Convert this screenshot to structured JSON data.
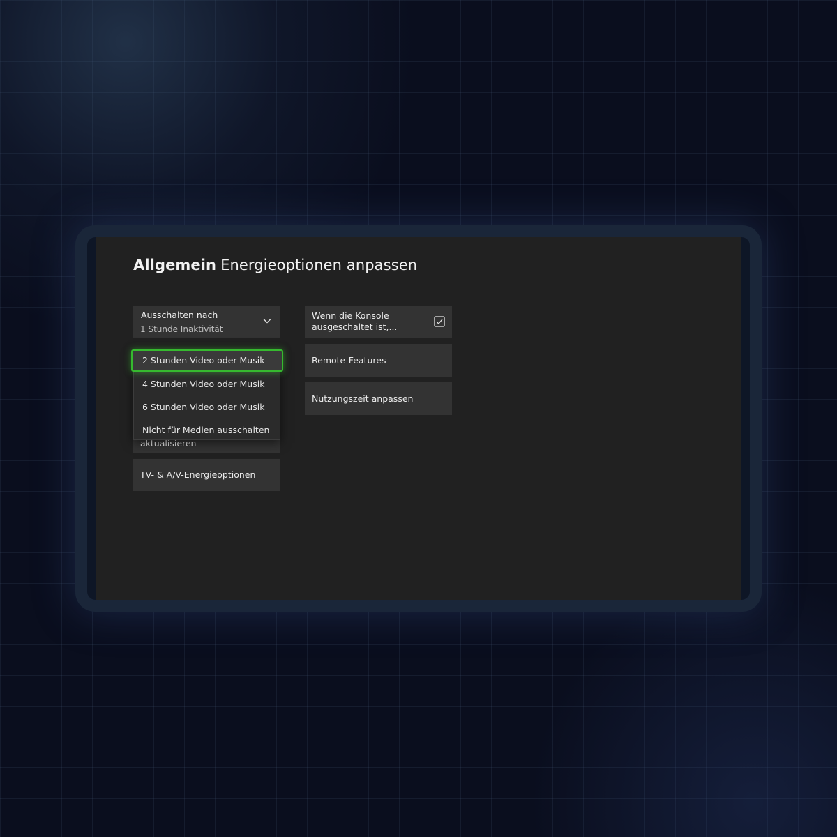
{
  "header": {
    "section": "Allgemein",
    "page": "Energieoptionen anpassen"
  },
  "left_column": {
    "shutdown_tile": {
      "label": "Ausschalten nach",
      "value": "1 Stunde Inaktivität",
      "icon": "chevron-down-icon"
    },
    "dropdown": {
      "options": [
        "2 Stunden Video oder Musik",
        "4 Stunden Video oder Musik",
        "6 Stunden Video oder Musik",
        "Nicht für Medien ausschalten"
      ],
      "highlighted": "2 Stunden Video oder Musik"
    },
    "update_tile": {
      "label_visible": "aktualisieren"
    },
    "tv_tile": {
      "label": "TV- & A/V-Energieoptionen"
    }
  },
  "right_column": {
    "console_off_tile": {
      "label": "Wenn die Konsole ausgeschaltet ist,...",
      "checked": true,
      "icon": "checkbox-checked-icon"
    },
    "remote_tile": {
      "label": "Remote-Features"
    },
    "usage_tile": {
      "label": "Nutzungszeit anpassen"
    }
  },
  "colors": {
    "focus": "#36b92f",
    "tile": "#333333",
    "screen_bg": "#212121"
  }
}
